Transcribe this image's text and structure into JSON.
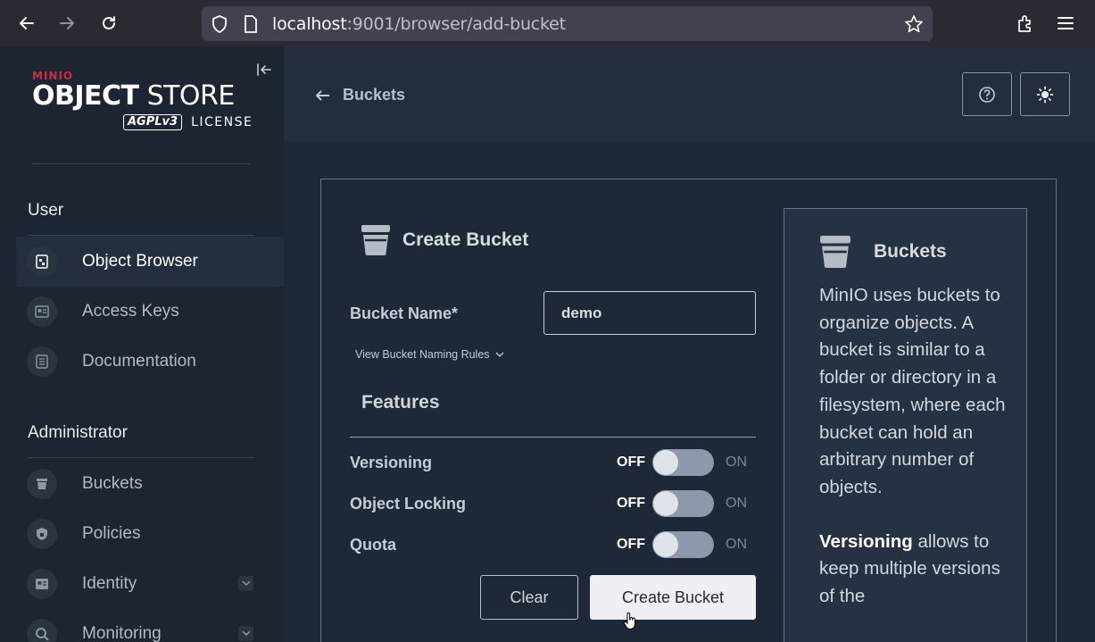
{
  "browser": {
    "url_host": "localhost",
    "url_rest": ":9001/browser/add-bucket"
  },
  "sidebar": {
    "logo": {
      "brand": "MINIO",
      "product_bold": "OBJECT",
      "product_light": "STORE",
      "license_badge": "AGPLv3",
      "license_text": "LICENSE"
    },
    "user_section": "User",
    "user_items": [
      {
        "label": "Object Browser",
        "icon": "object-browser-icon",
        "active": true
      },
      {
        "label": "Access Keys",
        "icon": "access-keys-icon"
      },
      {
        "label": "Documentation",
        "icon": "documentation-icon"
      }
    ],
    "admin_section": "Administrator",
    "admin_items": [
      {
        "label": "Buckets",
        "icon": "bucket-icon"
      },
      {
        "label": "Policies",
        "icon": "policies-icon"
      },
      {
        "label": "Identity",
        "icon": "identity-icon",
        "expandable": true
      },
      {
        "label": "Monitoring",
        "icon": "monitoring-icon",
        "expandable": true
      }
    ]
  },
  "header": {
    "back_label": "Buckets"
  },
  "form": {
    "title": "Create Bucket",
    "bucket_name_label": "Bucket Name*",
    "bucket_name_value": "demo",
    "naming_rules_link": "View Bucket Naming Rules",
    "features_title": "Features",
    "toggles": [
      {
        "label": "Versioning",
        "off": "OFF",
        "on": "ON",
        "state": "off"
      },
      {
        "label": "Object Locking",
        "off": "OFF",
        "on": "ON",
        "state": "off"
      },
      {
        "label": "Quota",
        "off": "OFF",
        "on": "ON",
        "state": "off"
      }
    ],
    "clear_label": "Clear",
    "create_label": "Create Bucket"
  },
  "help": {
    "title": "Buckets",
    "paragraph1": "MinIO uses buckets to organize objects. A bucket is similar to a folder or directory in a filesystem, where each bucket can hold an arbitrary number of objects.",
    "paragraph2_bold": "Versioning",
    "paragraph2_rest": " allows to keep multiple versions of the"
  }
}
